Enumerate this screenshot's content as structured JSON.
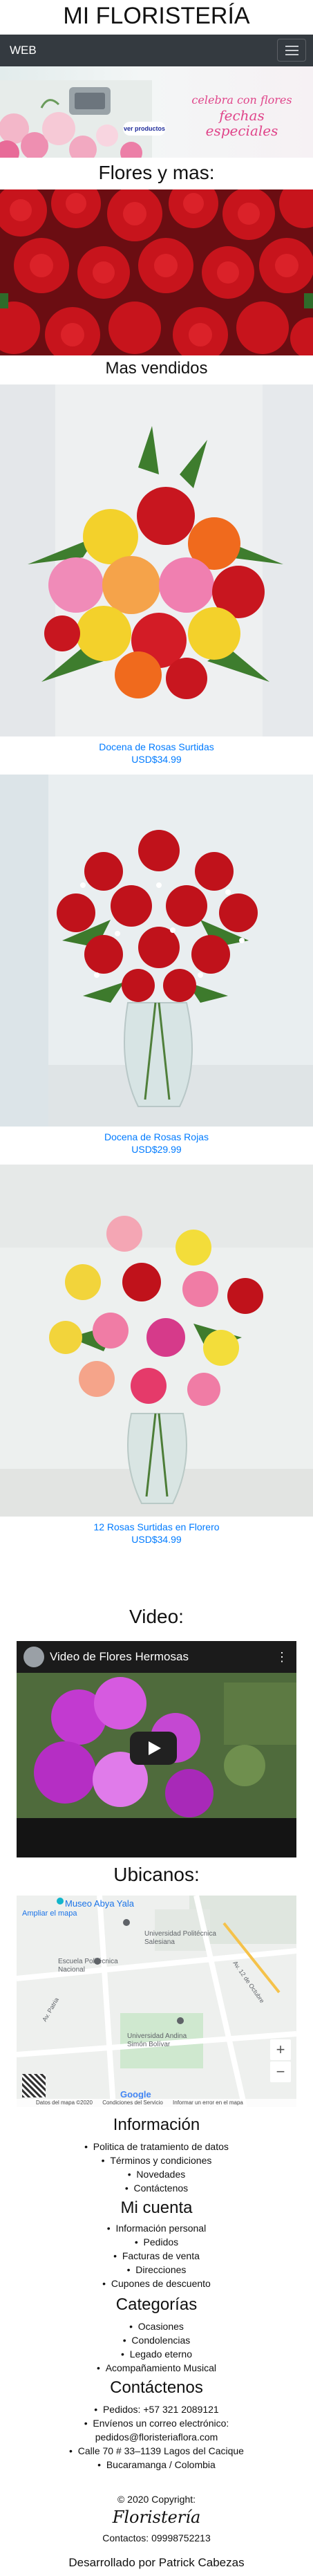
{
  "site_title": "MI FLORISTERÍA",
  "navbar": {
    "brand": "WEB"
  },
  "banner": {
    "line1": "celebra con flores",
    "line2": "fechas",
    "line3": "especiales",
    "badge": "ver productos"
  },
  "sections": {
    "flowers_heading": "Flores y mas:",
    "bestsellers_heading": "Mas vendidos",
    "video_heading": "Video:",
    "map_heading": "Ubicanos:"
  },
  "products": [
    {
      "name": "Docena de Rosas Surtidas",
      "price": "USD$34.99"
    },
    {
      "name": "Docena de Rosas Rojas",
      "price": "USD$29.99"
    },
    {
      "name": "12 Rosas Surtidas en Florero",
      "price": "USD$34.99"
    }
  ],
  "video": {
    "title": "Video de Flores Hermosas"
  },
  "map": {
    "place_name": "Museo Abya Yala",
    "enlarge_link": "Ampliar el mapa",
    "labels": [
      "Universidad Politécnica Salesiana",
      "Escuela Politécnica Nacional",
      "Universidad Andina Simón Bolívar",
      "Av. 12 de Octubre",
      "Av. Patria"
    ],
    "footer_items": [
      "Datos del mapa ©2020",
      "Condiciones del Servicio",
      "Informar un error en el mapa"
    ]
  },
  "footer": {
    "info": {
      "heading": "Información",
      "items": [
        "Politica de tratamiento de datos",
        "Términos y condiciones",
        "Novedades",
        "Contáctenos"
      ]
    },
    "account": {
      "heading": "Mi cuenta",
      "items": [
        "Información personal",
        "Pedidos",
        "Facturas de venta",
        "Direcciones",
        "Cupones de descuento"
      ]
    },
    "categories": {
      "heading": "Categorías",
      "items": [
        "Ocasiones",
        "Condolencias",
        "Legado eterno",
        "Acompañamiento Musical"
      ]
    },
    "contact": {
      "heading": "Contáctenos",
      "items": [
        "Pedidos: +57 321 2089121",
        "Envíenos un correo electrónico:",
        "pedidos@floristeriaflora.com",
        "Calle 70 # 33–1139 Lagos del Cacique",
        "Bucaramanga / Colombia"
      ]
    },
    "copyright": "© 2020 Copyright:",
    "brand": "Floristería",
    "contacts_line": "Contactos: 09998752213",
    "developer": "Desarrollado por Patrick Cabezas"
  }
}
